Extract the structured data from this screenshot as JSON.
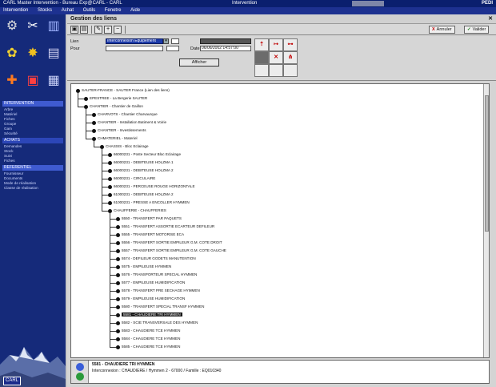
{
  "titlebar": {
    "left": "CARL Master Intervention - Bureau Exp@CARL - CARL",
    "middle": "Intervention",
    "right": "PEDI"
  },
  "menubar": [
    "Intervention",
    "Stocks",
    "Achat",
    "Outils",
    "Fenetre",
    "Aide"
  ],
  "sidebar": {
    "icons": [
      "gear-icon",
      "wrench-icon",
      "building-icon",
      "flower-icon",
      "star-icon",
      "chart-icon",
      "plus-icon",
      "calendar-icon",
      "document-icon"
    ],
    "sections": [
      {
        "header": "INTERVENTION",
        "items": [
          "Arbre",
          "Matériel",
          "Fiches",
          "Groupe",
          "Gam",
          "Sécurité"
        ]
      },
      {
        "header": "ACHATS",
        "items": [
          "Demandes",
          "Stock",
          "Suivi",
          "Fiches"
        ]
      },
      {
        "header": "REFERENTIEL",
        "items": [
          "Fournisseur",
          "Documents",
          "Mode de réalisation",
          "Classe de réalisation"
        ]
      }
    ],
    "logo": "CARL"
  },
  "window": {
    "title": "Gestion des liens",
    "toolbar": {
      "actions": [
        {
          "mark": "X",
          "label": "Annuler"
        },
        {
          "mark": "✓",
          "label": "Valider"
        }
      ]
    }
  },
  "form": {
    "lien_label": "Lien",
    "lien_value": "Interconnexion Equipement",
    "pour_label": "Pour",
    "pour_value": "",
    "date_label": "Date",
    "date_value": "06/06/2002 14:57:00",
    "afficher_label": "Afficher"
  },
  "tree": {
    "nodes": [
      {
        "code": "SAUTER-FRANCE",
        "label": "SAUTER France (Lien des liens)",
        "level": 0
      },
      {
        "code": "EPESTREE",
        "label": "La Bergerie SAUTER",
        "level": 1
      },
      {
        "code": "CHANTIER",
        "label": "Chantier de Gaillon",
        "level": 1
      },
      {
        "code": "CHARVOTS",
        "label": "Chantier Charvaurque",
        "level": 2
      },
      {
        "code": "CHANTIER",
        "label": "Installation Batiment & Voirie",
        "level": 2
      },
      {
        "code": "CHANTIER",
        "label": "Investissements",
        "level": 2
      },
      {
        "code": "CHMATERIEL",
        "label": "Materiel",
        "level": 2
      },
      {
        "code": "CHASSIS",
        "label": "Bloc Eclairage",
        "level": 3
      },
      {
        "code": "66000231",
        "label": "Poste Secteur Bloc Eclairage",
        "level": 4
      },
      {
        "code": "66000231",
        "label": "DEBITEUSE HOLZMA 1",
        "level": 4
      },
      {
        "code": "66000231",
        "label": "DEBITEUSE HOLZMA 2",
        "level": 4
      },
      {
        "code": "66000231",
        "label": "CIRCULAIRE",
        "level": 4
      },
      {
        "code": "66000231",
        "label": "PERCEUSE ROUGE HORIZONTALE",
        "level": 4
      },
      {
        "code": "61000231",
        "label": "DEBITEUSE HOLZMA 2",
        "level": 4
      },
      {
        "code": "61000231",
        "label": "PRESSE A ENCOLLER HYMMEN",
        "level": 4
      },
      {
        "code": "CHAUFFERIE",
        "label": "CHAUFFERIES",
        "level": 4
      },
      {
        "code": "5550",
        "label": "TRANSFERT PAR PAQUETS",
        "level": 5
      },
      {
        "code": "5551",
        "label": "TRANSFERT ASSORTIE ECARTEUR DEFILEUR",
        "level": 5
      },
      {
        "code": "5555",
        "label": "TRANSFERT MOTORISE ECA",
        "level": 5
      },
      {
        "code": "5556",
        "label": "TRANSFERT SORTIE EMPILEUR G.M. COTE DROIT",
        "level": 5
      },
      {
        "code": "5557",
        "label": "TRANSFERT SORTIE EMPILEUR G.M. COTE GAUCHE",
        "level": 5
      },
      {
        "code": "5574",
        "label": "DEFILEUR GODETS MANUTENTION",
        "level": 5
      },
      {
        "code": "5575",
        "label": "EMPILEUSE HYMMEN",
        "level": 5
      },
      {
        "code": "5576",
        "label": "TRANSPORTEUR SPECIAL HYMMEN",
        "level": 5
      },
      {
        "code": "5577",
        "label": "EMPILEUSE HUMIDIFICATION",
        "level": 5
      },
      {
        "code": "5578",
        "label": "TRANSFERT PRE SECHAGE HYMMEN",
        "level": 5
      },
      {
        "code": "5579",
        "label": "EMPILEUSE HUMIDIFICATION",
        "level": 5
      },
      {
        "code": "5580",
        "label": "TRANSFERT SPECIAL TRANSF HYMMEN",
        "level": 5
      },
      {
        "code": "5581",
        "label": "CHAUDIERE TRI HYMMEN",
        "level": 5,
        "selected": true
      },
      {
        "code": "5582",
        "label": "SCIE TRANSVERSALE DES HYMMEN",
        "level": 5
      },
      {
        "code": "5583",
        "label": "CHAUDIERE TCE HYMMEN",
        "level": 5
      },
      {
        "code": "5584",
        "label": "CHAUDIERE TCE HYMMEN",
        "level": 5
      },
      {
        "code": "5585",
        "label": "CHAUDIERE TCE HYMMEN",
        "level": 5
      }
    ]
  },
  "status": {
    "line1": "5581 - CHAUDIERE TRI HYMMEN",
    "line2": "Interconnexion : CHAUDIERE / Hymmen 2 - 67000 / Famille : EQ010340"
  }
}
